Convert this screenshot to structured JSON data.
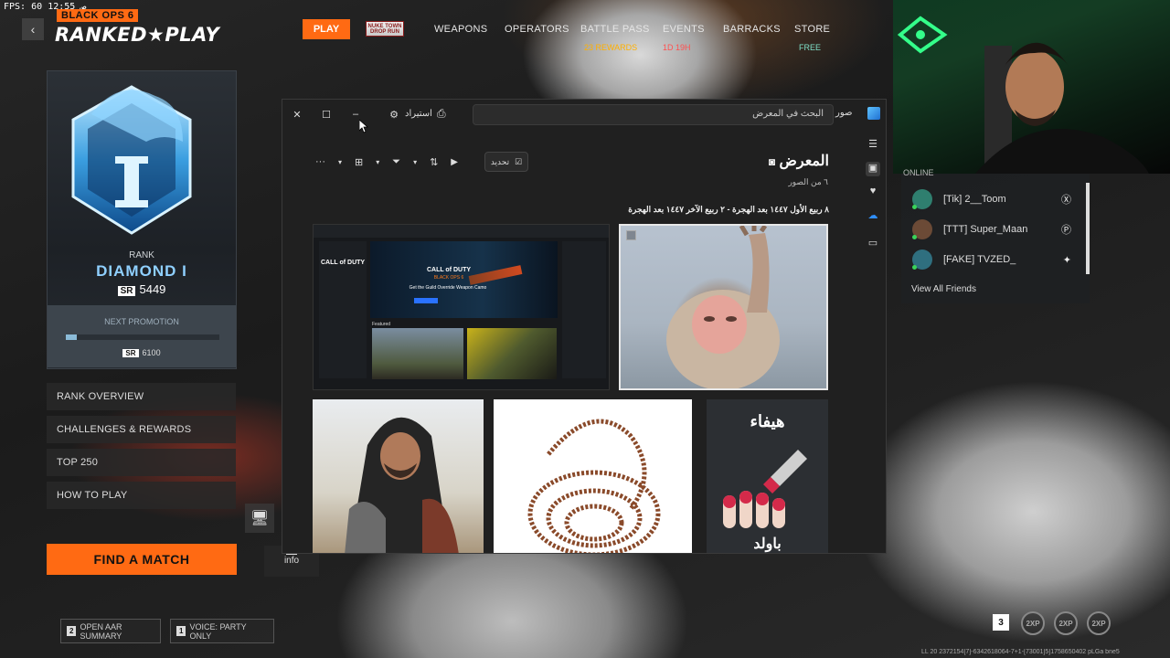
{
  "hud": {
    "fps_label": "FPS:",
    "fps_value": "60",
    "clock": "12:55 ص"
  },
  "game": {
    "logo_small": "BLACK OPS 6",
    "logo_big": "RANKED★PLAY",
    "back": "‹",
    "nav": {
      "play": "PLAY",
      "badge": "NUKE TOWN DROP RUN",
      "weapons": "WEAPONS",
      "operators": "OPERATORS",
      "battle_pass": "BATTLE PASS",
      "battle_pass_sub": "23 REWARDS",
      "events": "EVENTS",
      "events_sub": "1D 19H",
      "barracks": "BARRACKS",
      "store": "STORE",
      "store_sub": "FREE"
    },
    "rank": {
      "emblem_numeral": "I",
      "label": "RANK",
      "name": "DIAMOND I",
      "sr_tag": "SR",
      "sr_value": "5449",
      "promo_label": "NEXT PROMOTION",
      "promo_progress": 0.07,
      "promo_sr_tag": "SR",
      "promo_sr": "6100"
    },
    "menu": [
      "RANK OVERVIEW",
      "CHALLENGES & REWARDS",
      "TOP 250",
      "HOW TO PLAY"
    ],
    "find_match": "FIND A MATCH",
    "hints": [
      {
        "key": "2",
        "label": "OPEN AAR SUMMARY"
      },
      {
        "key": "1",
        "label": "VOICE: PARTY ONLY"
      }
    ],
    "info_key": "R",
    "info_label": "info",
    "friends": {
      "header": "ONLINE",
      "items": [
        {
          "name": "[Tik] 2__Toom",
          "platform": "xbox-icon",
          "color": "#2f7f6f"
        },
        {
          "name": "[TTT] Super_Maan",
          "platform": "playstation-icon",
          "color": "#6b4a36"
        },
        {
          "name": "[FAKE] TVZED_",
          "platform": "battlenet-icon",
          "color": "#2f6f7f"
        }
      ],
      "view_all": "View All Friends"
    },
    "party_count": "3",
    "xp_tokens": [
      "2XP",
      "2XP",
      "2XP"
    ],
    "coords": "LL 20 2372154[7]-6342618064-7+1-[73001]5]1758650402 pLGa bne5"
  },
  "gallery": {
    "app_name": "صور",
    "search_placeholder": "البحث في المعرض",
    "import_label": "استيراد",
    "title": "المعرض",
    "count": "٦ من الصور",
    "select_label": "تحديد",
    "date_range": "٨ ربيع الأول ١٤٤٧ بعد الهجرة - ٢ ربيع الآخر ١٤٤٧ بعد الهجرة",
    "shot": {
      "cod_logo": "CALL of DUTY",
      "bo6": "BLACK OPS 6",
      "headline": "Get the Guild Override Weapon Camo",
      "featured": "Featured"
    },
    "sticker_text_top": "هيفاء",
    "sticker_text_bottom": "باولد"
  },
  "colors": {
    "accent": "#ff6a13",
    "rank_blue": "#8fd0ff",
    "window_bg": "#202020"
  }
}
